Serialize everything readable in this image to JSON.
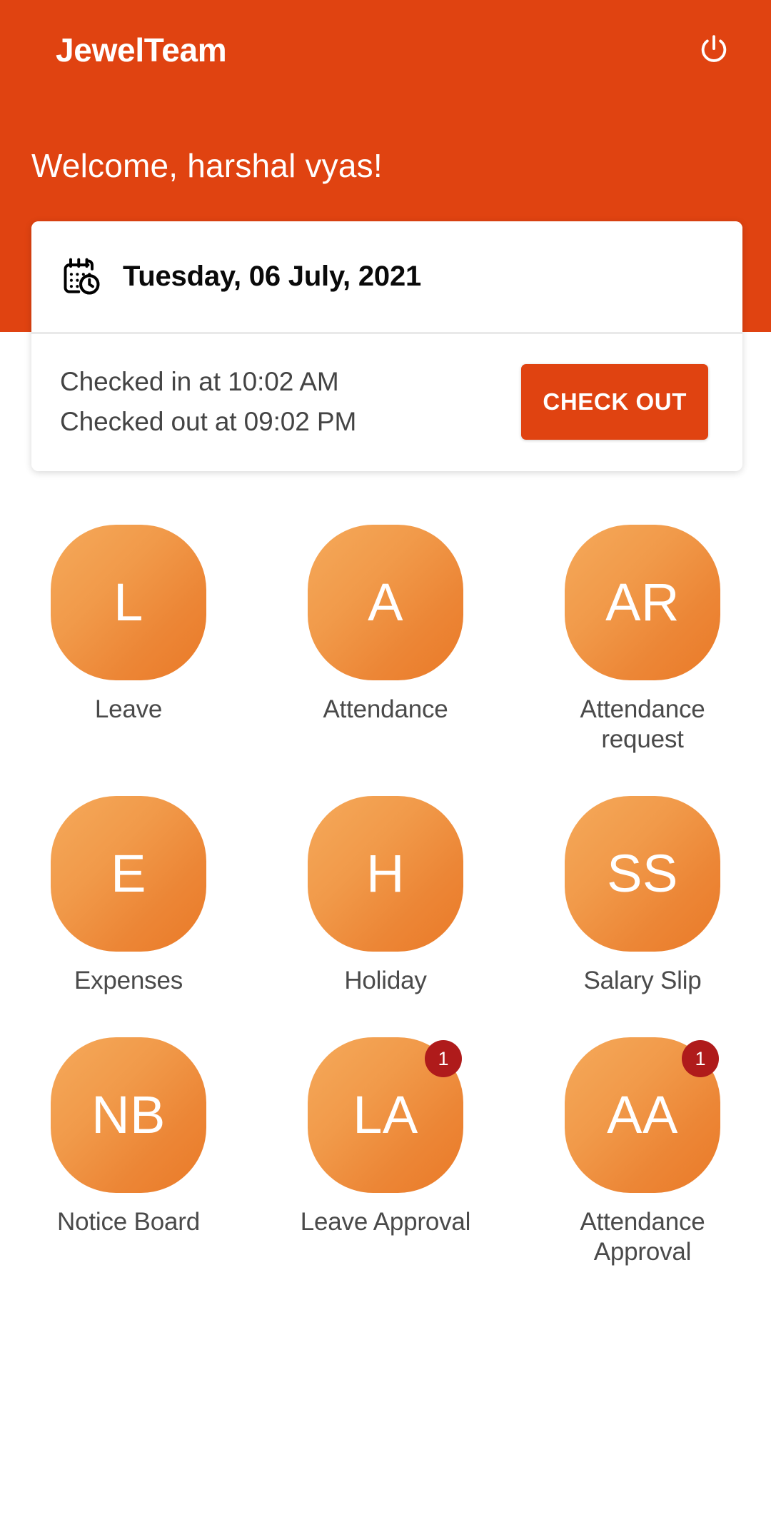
{
  "header": {
    "app_title": "JewelTeam",
    "power_icon": "power-icon",
    "welcome": "Welcome, harshal vyas!",
    "background_color": "#E04311"
  },
  "status_card": {
    "calendar_icon": "calendar-clock-icon",
    "date": "Tuesday, 06 July, 2021",
    "checked_in": "Checked in at 10:02 AM",
    "checked_out": "Checked out at 09:02 PM",
    "action_button": "CHECK OUT",
    "action_button_color": "#E04311"
  },
  "grid": {
    "tile_gradient_from": "#F5A95A",
    "tile_gradient_to": "#EA7A28",
    "badge_color": "#AF1B1B",
    "tiles": [
      {
        "initials": "L",
        "label": "Leave",
        "badge": null
      },
      {
        "initials": "A",
        "label": "Attendance",
        "badge": null
      },
      {
        "initials": "AR",
        "label": "Attendance request",
        "badge": null
      },
      {
        "initials": "E",
        "label": "Expenses",
        "badge": null
      },
      {
        "initials": "H",
        "label": "Holiday",
        "badge": null
      },
      {
        "initials": "SS",
        "label": "Salary Slip",
        "badge": null
      },
      {
        "initials": "NB",
        "label": "Notice Board",
        "badge": null
      },
      {
        "initials": "LA",
        "label": "Leave Approval",
        "badge": "1"
      },
      {
        "initials": "AA",
        "label": "Attendance Approval",
        "badge": "1"
      }
    ]
  }
}
